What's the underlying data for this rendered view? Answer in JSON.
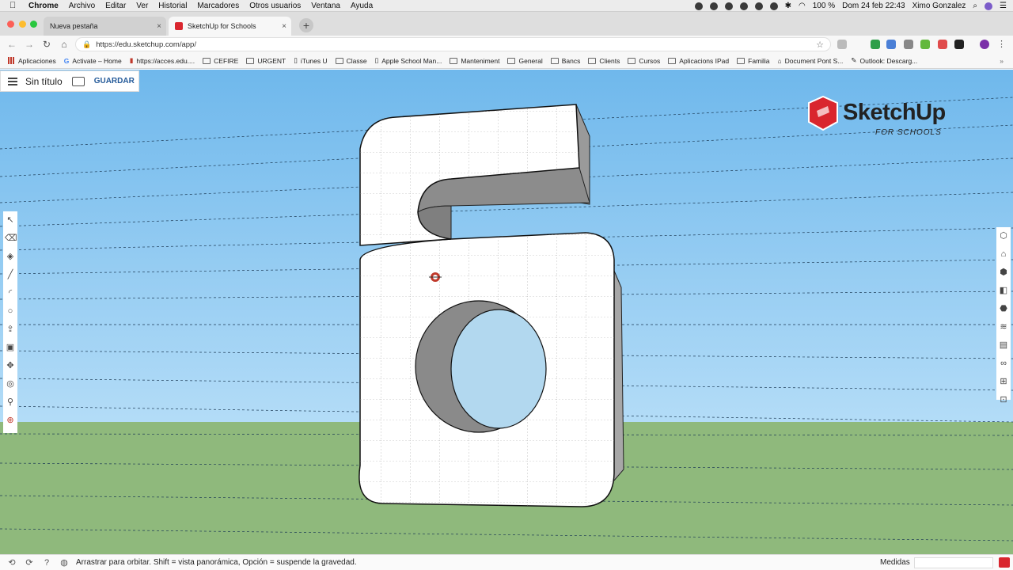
{
  "menubar": {
    "apple": "",
    "items": [
      "Chrome",
      "Archivo",
      "Editar",
      "Ver",
      "Historial",
      "Marcadores",
      "Otros usuarios",
      "Ventana",
      "Ayuda"
    ],
    "battery": "100 %",
    "datetime": "Dom 24 feb  22:43",
    "user": "Ximo Gonzalez"
  },
  "tabs": [
    {
      "title": "Nueva pestaña",
      "close": "×"
    },
    {
      "title": "SketchUp for Schools",
      "close": "×"
    }
  ],
  "toolbar": {
    "url": "https://edu.sketchup.com/app/",
    "new_tab": "+"
  },
  "bookmarks": [
    "Aplicaciones",
    "Activate – Home",
    "https://acces.edu....",
    "CEFIRE",
    "URGENT",
    "iTunes U",
    "Classe",
    "Apple School Man...",
    "Manteniment",
    "General",
    "Bancs",
    "Clients",
    "Cursos",
    "Aplicacions IPad",
    "Familia",
    "Document Pont S...",
    "Outlook: Descarg..."
  ],
  "app": {
    "title": "Sin título",
    "save_label": "GUARDAR",
    "logo_word": "SketchUp",
    "logo_sub": "FOR SCHOOLS"
  },
  "status": {
    "hint": "Arrastrar para orbitar. Shift = vista panorámica, Opción = suspende la gravedad.",
    "measures_label": "Medidas",
    "measures_value": ""
  },
  "icons": {
    "left_tools": [
      "select-icon",
      "eraser-icon",
      "paint-bucket-icon",
      "line-icon",
      "arc-icon",
      "circle-icon",
      "push-pull-icon",
      "offset-icon",
      "move-icon",
      "tape-measure-icon",
      "walk-icon",
      "orbit-icon"
    ],
    "right_tools": [
      "entity-info-icon",
      "instructor-icon",
      "components-icon",
      "materials-icon",
      "styles-icon",
      "layers-icon",
      "scenes-icon",
      "display-icon",
      "outliner-icon",
      "solid-tools-icon"
    ]
  },
  "colors": {
    "brand": "#d9262e",
    "sky_top": "#6fb8ec",
    "ground": "#8fb97c",
    "save_blue": "#245a99"
  }
}
